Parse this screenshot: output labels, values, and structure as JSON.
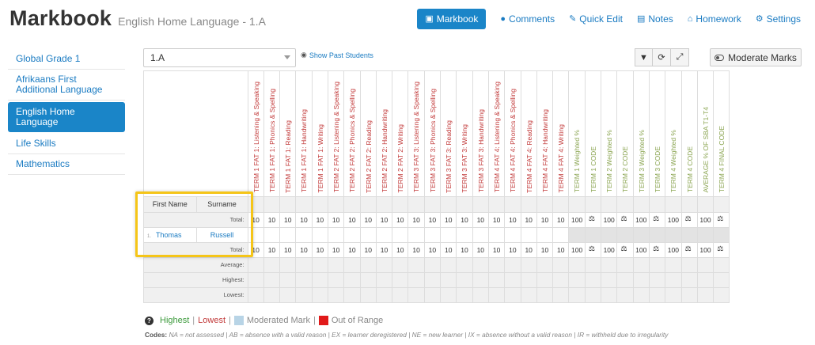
{
  "header": {
    "title": "Markbook",
    "subtitle": "English Home Language - 1.A"
  },
  "nav": [
    {
      "label": "Markbook",
      "icon": "book-icon",
      "active": true
    },
    {
      "label": "Comments",
      "icon": "comment-icon"
    },
    {
      "label": "Quick Edit",
      "icon": "brush-icon"
    },
    {
      "label": "Notes",
      "icon": "file-icon"
    },
    {
      "label": "Homework",
      "icon": "home-icon"
    },
    {
      "label": "Settings",
      "icon": "cogs-icon"
    }
  ],
  "sidebar": [
    {
      "label": "Global Grade 1"
    },
    {
      "label": "Afrikaans First Additional Language"
    },
    {
      "label": "English Home Language",
      "active": true
    },
    {
      "label": "Life Skills"
    },
    {
      "label": "Mathematics"
    }
  ],
  "toolbar": {
    "class_value": "1.A",
    "show_past": "Show Past Students",
    "moderate": "Moderate Marks"
  },
  "table": {
    "first_name_header": "First Name",
    "surname_header": "Surname",
    "total_label": "Total:",
    "average_label": "Average:",
    "highest_label": "Highest:",
    "lowest_label": "Lowest:",
    "fat_columns": [
      "TERM 1 FAT 1: Listening & Speaking",
      "TERM 1 FAT 1: Phonics & Spelling",
      "TERM 1 FAT 1: Reading",
      "TERM 1 FAT 1: Handwriting",
      "TERM 1 FAT 1: Writing",
      "TERM 2 FAT 2: Listening & Speaking",
      "TERM 2 FAT 2: Phonics & Spelling",
      "TERM 2 FAT 2: Reading",
      "TERM 2 FAT 2: Handwriting",
      "TERM 2 FAT 2: Writing",
      "TERM 3 FAT 3: Listening & Speaking",
      "TERM 3 FAT 3: Phonics & Spelling",
      "TERM 3 FAT 3: Reading",
      "TERM 3 FAT 3: Writing",
      "TERM 3 FAT 3: Handwriting",
      "TERM 4 FAT 4: Listening & Speaking",
      "TERM 4 FAT 4: Phonics & Spelling",
      "TERM 4 FAT 4: Reading",
      "TERM 4 FAT 4: Handwriting",
      "TERM 4 FAT 4: Writing"
    ],
    "summary_columns": [
      "TERM 1 Weighted %",
      "TERM 1 CODE",
      "TERM 2 Weighted %",
      "TERM 2 CODE",
      "TERM 3 Weighted %",
      "TERM 3 CODE",
      "TERM 4 Weighted %",
      "TERM 4 CODE",
      "AVERAGE % OF SBA T1-T4",
      "TERM 4 FINAL CODE"
    ],
    "fat_total": "10",
    "pct_total": "100",
    "student": {
      "index": "1.",
      "first": "Thomas",
      "last": "Russell"
    }
  },
  "legend": {
    "highest": "Highest",
    "lowest": "Lowest",
    "sep": "|",
    "moderated": "Moderated Mark",
    "out_of_range": "Out of Range",
    "moderated_color": "#b8d4e6",
    "out_of_range_color": "#e11a1a"
  },
  "codes": {
    "label": "Codes:",
    "text": "NA = not assessed | AB = absence with a valid reason | EX = learner deregistered | NE = new learner | IX = absence without a valid reason | IR = withheld due to irregularity"
  }
}
